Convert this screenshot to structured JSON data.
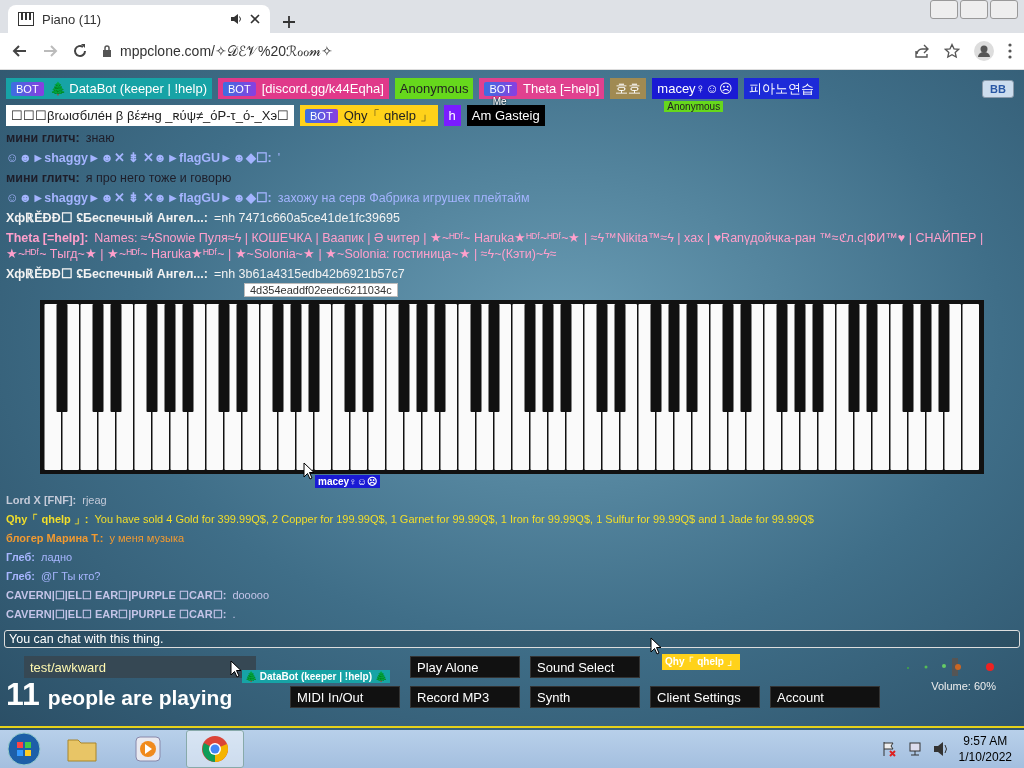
{
  "browser": {
    "tab_title": "Piano (11)",
    "url": "mppclone.com/✧𝒟ℰ𝒱%20ℛℴℴ𝓂✧"
  },
  "participants": [
    {
      "name": "🌲 DataBot (keeper | !help)",
      "badge": "BOT",
      "color": "#17a3a6"
    },
    {
      "name": "[discord.gg/k44Eqha]",
      "badge": "BOT",
      "color": "#e0398a"
    },
    {
      "name": "Anonymous",
      "color": "#66d81c"
    },
    {
      "name": "Theta [=help]",
      "badge": "BOT",
      "color": "#e0418f"
    },
    {
      "name": "호호",
      "color": "#a08a52"
    },
    {
      "name": "macey♀☺☹",
      "color": "#1a1ad4",
      "label_below": {
        "text": "Anonymous",
        "color": "#66d81c"
      }
    },
    {
      "name": "피아노연습",
      "color": "#1c2ad8"
    },
    {
      "name": "☐☐☐βrωισбιлéн β βέ≠нg _ʀύψ≠_όP-τ_ό-_Xэ☐",
      "color": "#ffffff"
    },
    {
      "name": "Qhy「 qhelp 」",
      "badge": "BOT",
      "color": "#ffd21a"
    },
    {
      "name": "h",
      "color": "#7a1cff"
    },
    {
      "name": "Am Gasteig",
      "color": "#000000",
      "label_above": {
        "text": "Me"
      }
    }
  ],
  "room_button": "BB",
  "chat_upper": [
    {
      "name": "мини глитч:",
      "text": "знаю",
      "color": "#1e1e2a"
    },
    {
      "name": "☺☻►shaggy►☻✕ ⇟ ✕☻►flagGU►☻◆☐:",
      "text": "'",
      "color": "#a4b4ff"
    },
    {
      "name": "мини глитч:",
      "text": "я про него тоже и говорю",
      "color": "#1e1e2a"
    },
    {
      "name": "☺☻►shaggy►☻✕ ⇟ ✕☻►flagGU►☻◆☐:",
      "text": "захожу на серв Фабрика игрушек плейтайм",
      "color": "#a4b4ff"
    },
    {
      "name": "ХфℝĚĐĐ☐ ʢБеспечный Ангел...:",
      "text": "=nh 7471c660a5ce41de1fc39695",
      "color": "#f2f2f2"
    },
    {
      "name": "Theta [=help]:",
      "text": "Names: ≈ϟSnowie Пуля≈ϟ | КОШЕЧКА | Ваапик | Ә читер | ★~ᴴᴰᶠ~ Haruka★ᴴᴰᶠ~ᴴᴰᶠ~★ | ≈ϟ™Nikita™≈ϟ | xax | ♥Ranγдойчка-ран ™≈ℭл.с|ФИ™♥ | СНАЙПЕР | ★~ᴴᴰᶠ~ Tыгд~★ | ★~ᴴᴰᶠ~ Haruka★ᴴᴰᶠ~ | ★~Solonia~★ | ★~Solonia: гостиница~★ | ≈ϟ~(Кэти)~ϟ≈",
      "color": "#ffa0cc"
    },
    {
      "name": "ХфℝĚĐĐ☐ ʢБеспечный Ангел...:",
      "text": "=nh 3b61a4315edb42b6921b57c7",
      "color": "#f2f2f2"
    }
  ],
  "piano_tooltip": "4d354eaddf02eedc6211034c",
  "chat_lower": [
    {
      "name": "Lord X [FNF]:",
      "text": "rjeag",
      "color": "#c4cad8"
    },
    {
      "name": "Qhy「 qhelp 」:",
      "text": "You have sold 4 Gold for 399.99Q$, 2 Copper for 199.99Q$, 1 Garnet for 99.99Q$, 1 Iron for 99.99Q$, 1 Sulfur for 99.99Q$ and 1 Jade for 99.99Q$",
      "color": "#f2de2a"
    },
    {
      "name": "блогер Марина Т.:",
      "text": "у меня музыка",
      "color": "#f29a30"
    },
    {
      "name": "Глеб:",
      "text": "ладно",
      "color": "#a8b6ff"
    },
    {
      "name": "Глеб:",
      "text": "@Г Ты кто?",
      "color": "#a8b6ff"
    },
    {
      "name": "CAVERN|☐|EL☐ EAR☐|PURPLE ☐CAR☐:",
      "text": "dooooo",
      "color": "#c4c4e8"
    },
    {
      "name": "CAVERN|☐|EL☐ EAR☐|PURPLE ☐CAR☐:",
      "text": ".",
      "color": "#c4c4e8"
    }
  ],
  "cursors": [
    {
      "label": "macey♀☺☹",
      "color": "#1a1ad4"
    },
    {
      "label": "Qhy「 qhelp 」",
      "color": "#ffd21a"
    },
    {
      "label": "🌲 DataBot (keeper | !help) 🌲",
      "color": "#17a3a6"
    }
  ],
  "chat_input": {
    "placeholder": "You can chat with this thing."
  },
  "name_field": {
    "value": "test/awkward"
  },
  "player_count": {
    "number": "11",
    "label": "people are playing"
  },
  "buttons": [
    [
      "Play Alone",
      "Sound Select"
    ],
    [
      "MIDI In/Out",
      "Record MP3",
      "Synth",
      "Client Settings",
      "Account"
    ]
  ],
  "volume": {
    "label": "Volume: 60%",
    "level": 0.6
  },
  "taskbar": {
    "time": "9:57 AM",
    "date": "1/10/2022"
  }
}
